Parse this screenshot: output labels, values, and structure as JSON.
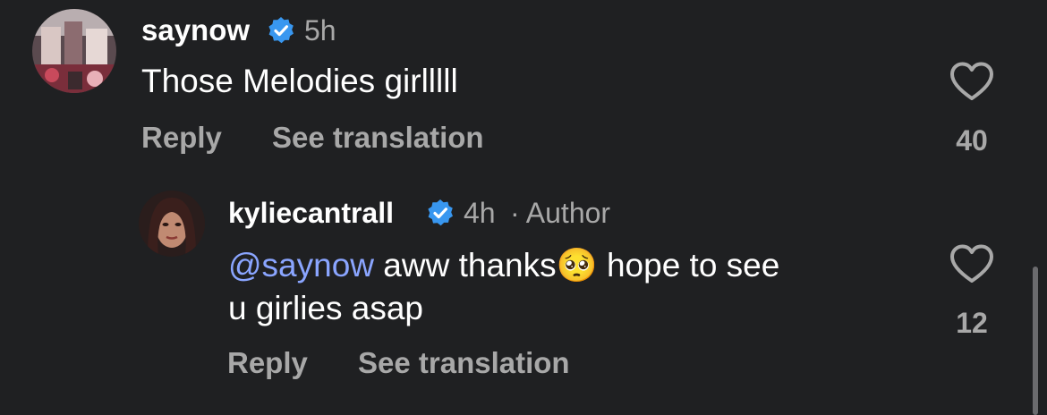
{
  "comments": [
    {
      "username": "saynow",
      "time": "5h",
      "author_tag": "",
      "mention": "",
      "text_line1": "Those Melodies girlllll",
      "text_line2": "",
      "reply_label": "Reply",
      "translate_label": "See translation",
      "like_count": "40"
    },
    {
      "username": "kyliecantrall",
      "time": "4h",
      "author_tag": "· Author",
      "mention": "@saynow",
      "text_line1": " aww thanks🥺  hope to see",
      "text_line2": "u girlies asap",
      "reply_label": "Reply",
      "translate_label": "See translation",
      "like_count": "12"
    }
  ],
  "colors": {
    "background": "#1f2022",
    "verified": "#3897f0",
    "mention": "#8aa5ff",
    "secondary_text": "#a8a8a8"
  },
  "icons": {
    "verified": "verified-badge-icon",
    "like": "heart-outline-icon"
  }
}
